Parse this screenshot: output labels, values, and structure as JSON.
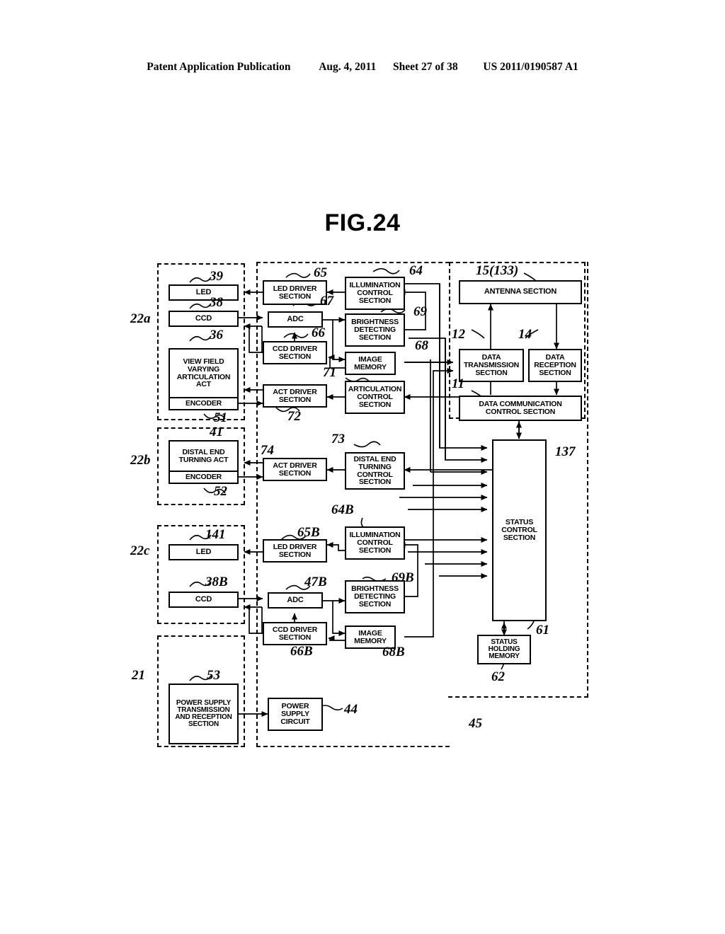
{
  "header": {
    "publication": "Patent Application Publication",
    "date": "Aug. 4, 2011",
    "sheet": "Sheet 27 of 38",
    "docnum": "US 2011/0190587 A1"
  },
  "figure": {
    "title": "FIG.24"
  },
  "groups": [
    {
      "id": "g22a",
      "label": "22a"
    },
    {
      "id": "g22b",
      "label": "22b"
    },
    {
      "id": "g22c",
      "label": "22c"
    },
    {
      "id": "g21",
      "label": "21"
    },
    {
      "id": "g137",
      "label": "137"
    },
    {
      "id": "g45",
      "label": "45"
    }
  ],
  "blocks": {
    "led_a": {
      "label": "LED",
      "ref": "39"
    },
    "ccd_a": {
      "label": "CCD",
      "ref": "38"
    },
    "view_field": {
      "label": "VIEW FIELD VARYING ARTICULATION ACT",
      "ref": "36",
      "sub": "ENCODER",
      "sub_ref": "51"
    },
    "led_driver": {
      "label": "LED DRIVER SECTION",
      "ref": "65"
    },
    "adc": {
      "label": "ADC",
      "ref": "67"
    },
    "ccd_driver": {
      "label": "CCD DRIVER SECTION",
      "ref": "66"
    },
    "act_driver": {
      "label": "ACT DRIVER SECTION",
      "ref": "72"
    },
    "illum_ctrl": {
      "label": "ILLUMINATION CONTROL SECTION",
      "ref": "64"
    },
    "brightness": {
      "label": "BRIGHTNESS DETECTING SECTION",
      "ref": "69"
    },
    "image_mem": {
      "label": "IMAGE MEMORY",
      "ref": "68"
    },
    "artic_ctrl": {
      "label": "ARTICULATION CONTROL SECTION",
      "ref": "71"
    },
    "antenna": {
      "label": "ANTENNA SECTION",
      "ref": "15(133)"
    },
    "data_tx": {
      "label": "DATA TRANSMISSION SECTION",
      "ref": "12"
    },
    "data_rx": {
      "label": "DATA RECEPTION SECTION",
      "ref": "14"
    },
    "data_comm": {
      "label": "DATA COMMUNICATION CONTROL SECTION",
      "ref": "11"
    },
    "distal_act": {
      "label": "DISTAL END TURNING ACT",
      "ref": "41",
      "sub": "ENCODER",
      "sub_ref": "52"
    },
    "act_driver_b": {
      "label": "ACT DRIVER SECTION",
      "ref": "74"
    },
    "distal_ctrl": {
      "label": "DISTAL END TURNING CONTROL SECTION",
      "ref": "73"
    },
    "status_ctrl": {
      "label": "STATUS CONTROL SECTION",
      "ref": "61"
    },
    "led_c": {
      "label": "LED",
      "ref": "141"
    },
    "led_driver_b": {
      "label": "LED DRIVER SECTION",
      "ref": "65B"
    },
    "illum_ctrl_b": {
      "label": "ILLUMINATION CONTROL SECTION",
      "ref": "64B"
    },
    "ccd_c": {
      "label": "CCD",
      "ref": "38B"
    },
    "adc_b": {
      "label": "ADC",
      "ref": "47B"
    },
    "ccd_driver_b": {
      "label": "CCD DRIVER SECTION",
      "ref": "66B"
    },
    "brightness_b": {
      "label": "BRIGHTNESS DETECTING SECTION",
      "ref": "69B"
    },
    "image_mem_b": {
      "label": "IMAGE MEMORY",
      "ref": "68B"
    },
    "status_mem": {
      "label": "STATUS HOLDING MEMORY",
      "ref": "62"
    },
    "power_tx": {
      "label": "POWER SUPPLY TRANSMISSION AND RECEPTION SECTION",
      "ref": "53"
    },
    "power_circ": {
      "label": "POWER SUPPLY CIRCUIT",
      "ref": "44"
    }
  },
  "colors": {
    "ink": "#000000",
    "paper": "#ffffff"
  }
}
